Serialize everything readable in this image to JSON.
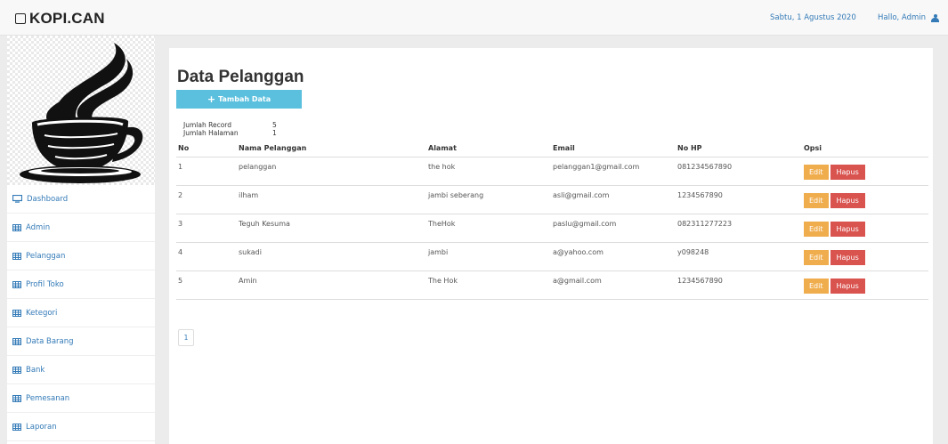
{
  "navbar": {
    "brand": "KOPI.CAN",
    "date": "Sabtu, 1 Agustus 2020",
    "greeting": "Hallo, Admin"
  },
  "sidebar": {
    "items": [
      {
        "label": "Dashboard",
        "icon": "monitor-icon"
      },
      {
        "label": "Admin",
        "icon": "table-icon"
      },
      {
        "label": "Pelanggan",
        "icon": "table-icon"
      },
      {
        "label": "Profil Toko",
        "icon": "table-icon"
      },
      {
        "label": "Ketegori",
        "icon": "table-icon"
      },
      {
        "label": "Data Barang",
        "icon": "table-icon"
      },
      {
        "label": "Bank",
        "icon": "table-icon"
      },
      {
        "label": "Pemesanan",
        "icon": "table-icon"
      },
      {
        "label": "Laporan",
        "icon": "table-icon"
      }
    ]
  },
  "main": {
    "title": "Data Pelanggan",
    "add_button": "Tambah Data",
    "info": {
      "record_label": "Jumlah Record",
      "record_value": "5",
      "pages_label": "Jumlah Halaman",
      "pages_value": "1"
    },
    "table": {
      "headers": [
        "No",
        "Nama Pelanggan",
        "Alamat",
        "Email",
        "No HP",
        "Opsi"
      ],
      "edit_label": "Edit",
      "delete_label": "Hapus",
      "rows": [
        {
          "no": "1",
          "nama": "pelanggan",
          "alamat": "the hok",
          "email": "pelanggan1@gmail.com",
          "hp": "081234567890"
        },
        {
          "no": "2",
          "nama": "ilham",
          "alamat": "jambi seberang",
          "email": "asli@gmail.com",
          "hp": "1234567890"
        },
        {
          "no": "3",
          "nama": "Teguh Kesuma",
          "alamat": "TheHok",
          "email": "paslu@gmail.com",
          "hp": "082311277223"
        },
        {
          "no": "4",
          "nama": "sukadi",
          "alamat": "jambi",
          "email": "a@yahoo.com",
          "hp": "y098248"
        },
        {
          "no": "5",
          "nama": "Amin",
          "alamat": "The Hok",
          "email": "a@gmail.com",
          "hp": "1234567890"
        }
      ]
    },
    "pagination": [
      "1"
    ]
  },
  "colors": {
    "link": "#337ab7",
    "info_button": "#5bc0de",
    "edit_button": "#f0ad4e",
    "delete_button": "#d9534f"
  }
}
